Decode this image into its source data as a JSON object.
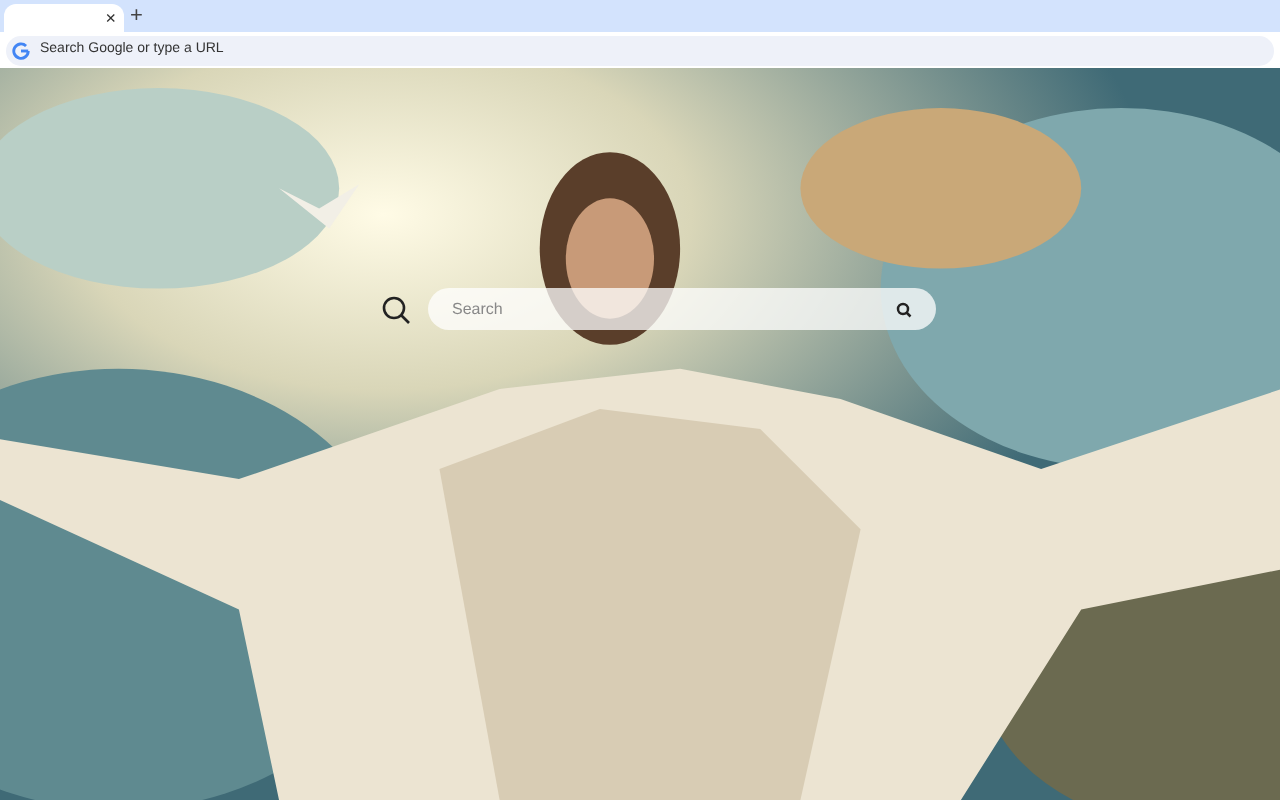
{
  "tab_strip": {
    "tabs": [
      {
        "close": "×",
        "selected": true
      }
    ],
    "new_tab": "+"
  },
  "address_bar": {
    "placeholder": "Search Google or type a URL"
  },
  "search": {
    "placeholder": "Search"
  }
}
